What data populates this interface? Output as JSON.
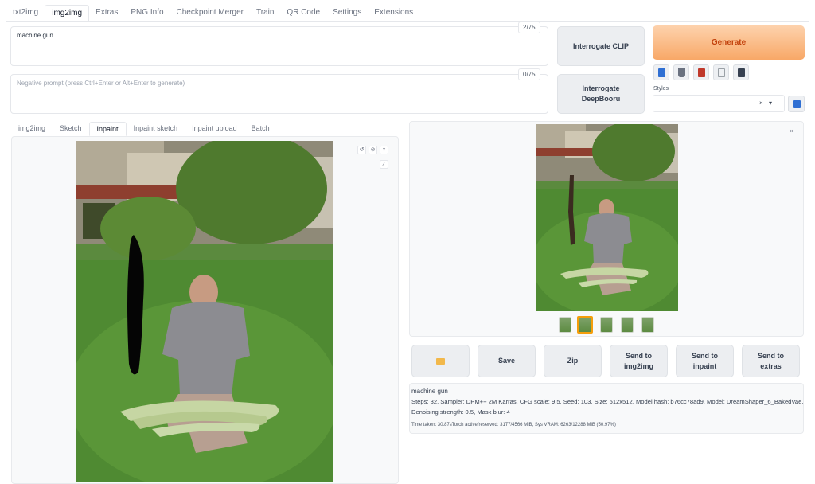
{
  "nav": {
    "tabs": [
      "txt2img",
      "img2img",
      "Extras",
      "PNG Info",
      "Checkpoint Merger",
      "Train",
      "QR Code",
      "Settings",
      "Extensions"
    ],
    "active": "img2img"
  },
  "prompt": {
    "value": "machine gun",
    "token_count": "2/75"
  },
  "negative_prompt": {
    "placeholder": "Negative prompt (press Ctrl+Enter or Alt+Enter to generate)",
    "token_count": "0/75"
  },
  "buttons": {
    "interrogate_clip": "Interrogate CLIP",
    "interrogate_deepbooru_line1": "Interrogate",
    "interrogate_deepbooru_line2": "DeepBooru",
    "generate": "Generate"
  },
  "toolbar": {
    "icons": [
      "paste-prompt-icon",
      "clear-prompt-icon",
      "show-extra-networks-icon",
      "apply-style-icon",
      "save-style-icon"
    ],
    "colors": [
      "#2f6fd3",
      "#6b7280",
      "#c0392b",
      "#9aa0a6",
      "#374151"
    ]
  },
  "styles": {
    "label": "Styles",
    "clear_glyph": "×",
    "dropdown_glyph": "▾"
  },
  "subtabs": {
    "tabs": [
      "img2img",
      "Sketch",
      "Inpaint",
      "Inpaint sketch",
      "Inpaint upload",
      "Batch"
    ],
    "active": "Inpaint"
  },
  "canvas_controls": {
    "undo": "↺",
    "clear": "⊘",
    "close": "×",
    "brush": "⁄"
  },
  "output": {
    "close": "×",
    "actions": [
      "Save",
      "Zip"
    ],
    "send_to_img2img": [
      "Send to",
      "img2img"
    ],
    "send_to_inpaint": [
      "Send to",
      "inpaint"
    ],
    "send_to_extras": [
      "Send to",
      "extras"
    ],
    "folder_icon": "folder-icon",
    "thumbnail_count": 5,
    "selected_thumbnail": 2
  },
  "generation_info": {
    "prompt": "machine gun",
    "params_line1": "Steps: 32, Sampler: DPM++ 2M Karras, CFG scale: 9.5, Seed: 103, Size: 512x512, Model hash: b76cc78ad9, Model: DreamShaper_6_BakedVae,",
    "params_line2": "Denoising strength: 0.5, Mask blur: 4",
    "timing": "Time taken: 30.87sTorch active/reserved: 3177/4566 MiB, Sys VRAM: 6263/12288 MiB (50.97%)"
  }
}
